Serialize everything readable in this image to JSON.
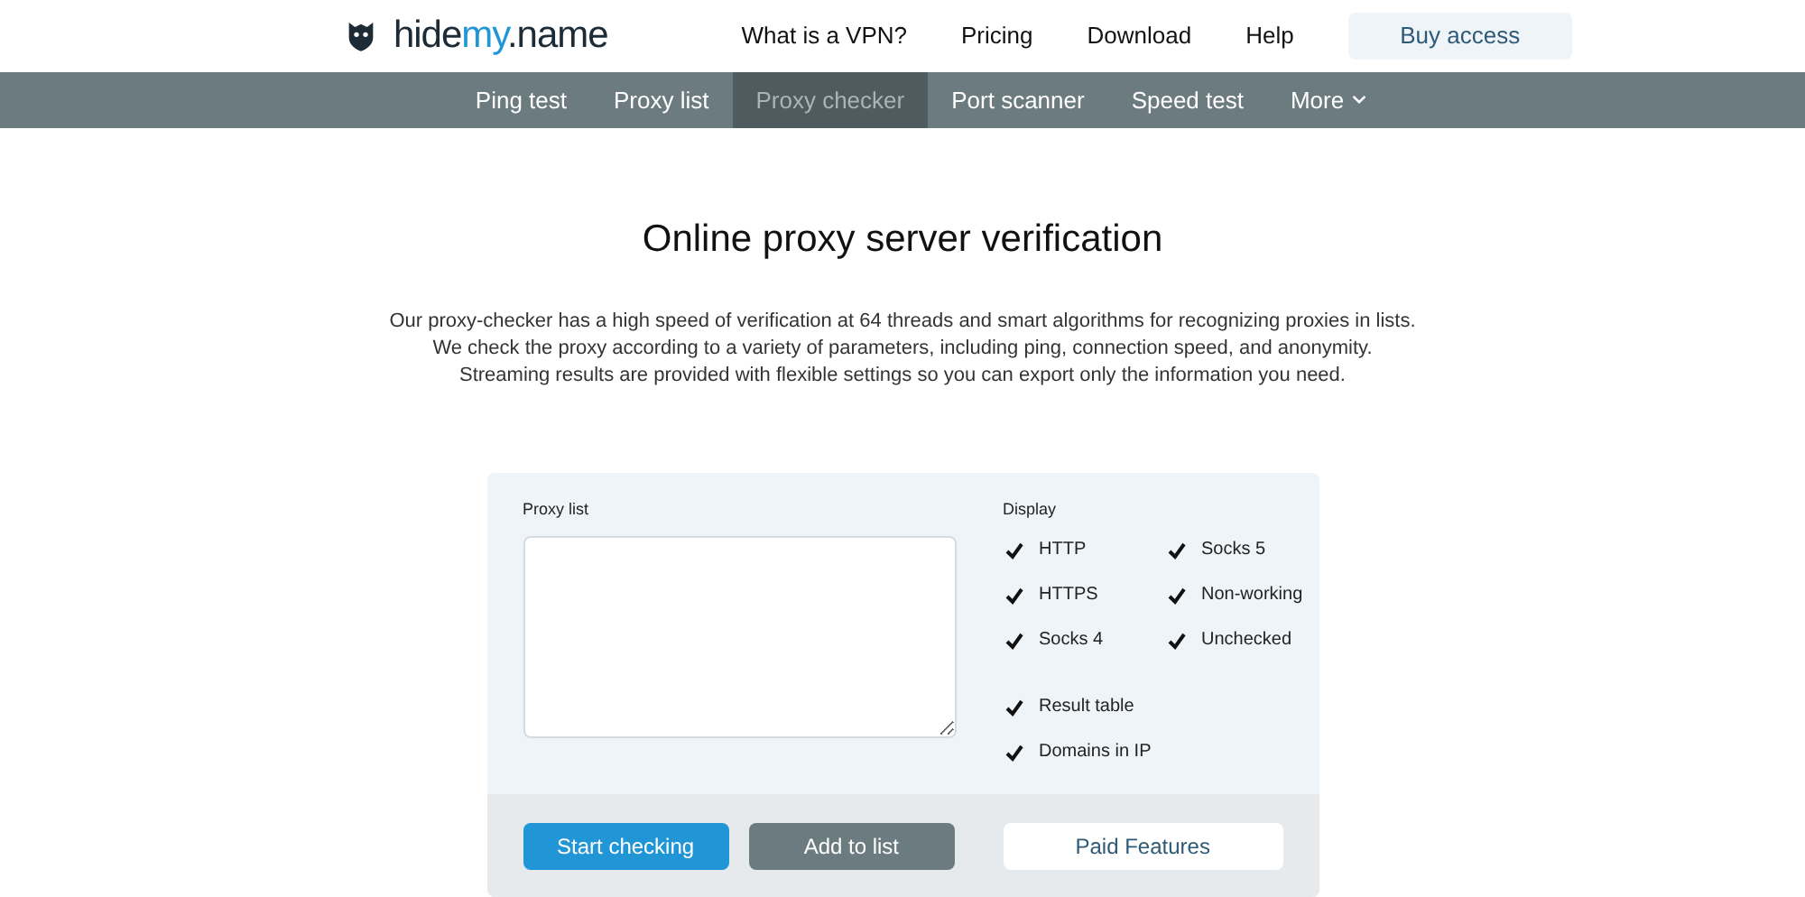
{
  "logo": [
    {
      "text": "hide",
      "highlight": false
    },
    {
      "text": "my",
      "highlight": true
    },
    {
      "text": ".name",
      "highlight": false
    }
  ],
  "top_nav": [
    "What is a VPN?",
    "Pricing",
    "Download",
    "Help"
  ],
  "buy_button": "Buy access",
  "tools_nav": [
    {
      "label": "Ping test",
      "selected": false
    },
    {
      "label": "Proxy list",
      "selected": false
    },
    {
      "label": "Proxy checker",
      "selected": true
    },
    {
      "label": "Port scanner",
      "selected": false
    },
    {
      "label": "Speed test",
      "selected": false
    },
    {
      "label": "More",
      "selected": false,
      "dropdown": true
    }
  ],
  "title": "Online proxy server verification",
  "intro": [
    "Our proxy-checker has a high speed of verification at 64 threads and smart algorithms for recognizing proxies in lists.",
    "We check the proxy according to a variety of parameters, including ping, connection speed, and anonymity.",
    "Streaming results are provided with flexible settings so you can export only the information you need."
  ],
  "form": {
    "proxy_list_label": "Proxy list",
    "display_label": "Display",
    "type_options": [
      {
        "label": "HTTP",
        "checked": true
      },
      {
        "label": "Socks 5",
        "checked": true
      },
      {
        "label": "HTTPS",
        "checked": true
      },
      {
        "label": "Non-working",
        "checked": true
      },
      {
        "label": "Socks 4",
        "checked": true
      },
      {
        "label": "Unchecked",
        "checked": true
      }
    ],
    "extra_options": [
      {
        "label": "Result table",
        "checked": true
      },
      {
        "label": "Domains in IP",
        "checked": true
      }
    ],
    "buttons": [
      {
        "label": "Start checking",
        "kind": "primary"
      },
      {
        "label": "Add to list",
        "kind": "secondary"
      },
      {
        "label": "Paid Features",
        "kind": "outline"
      }
    ]
  }
}
